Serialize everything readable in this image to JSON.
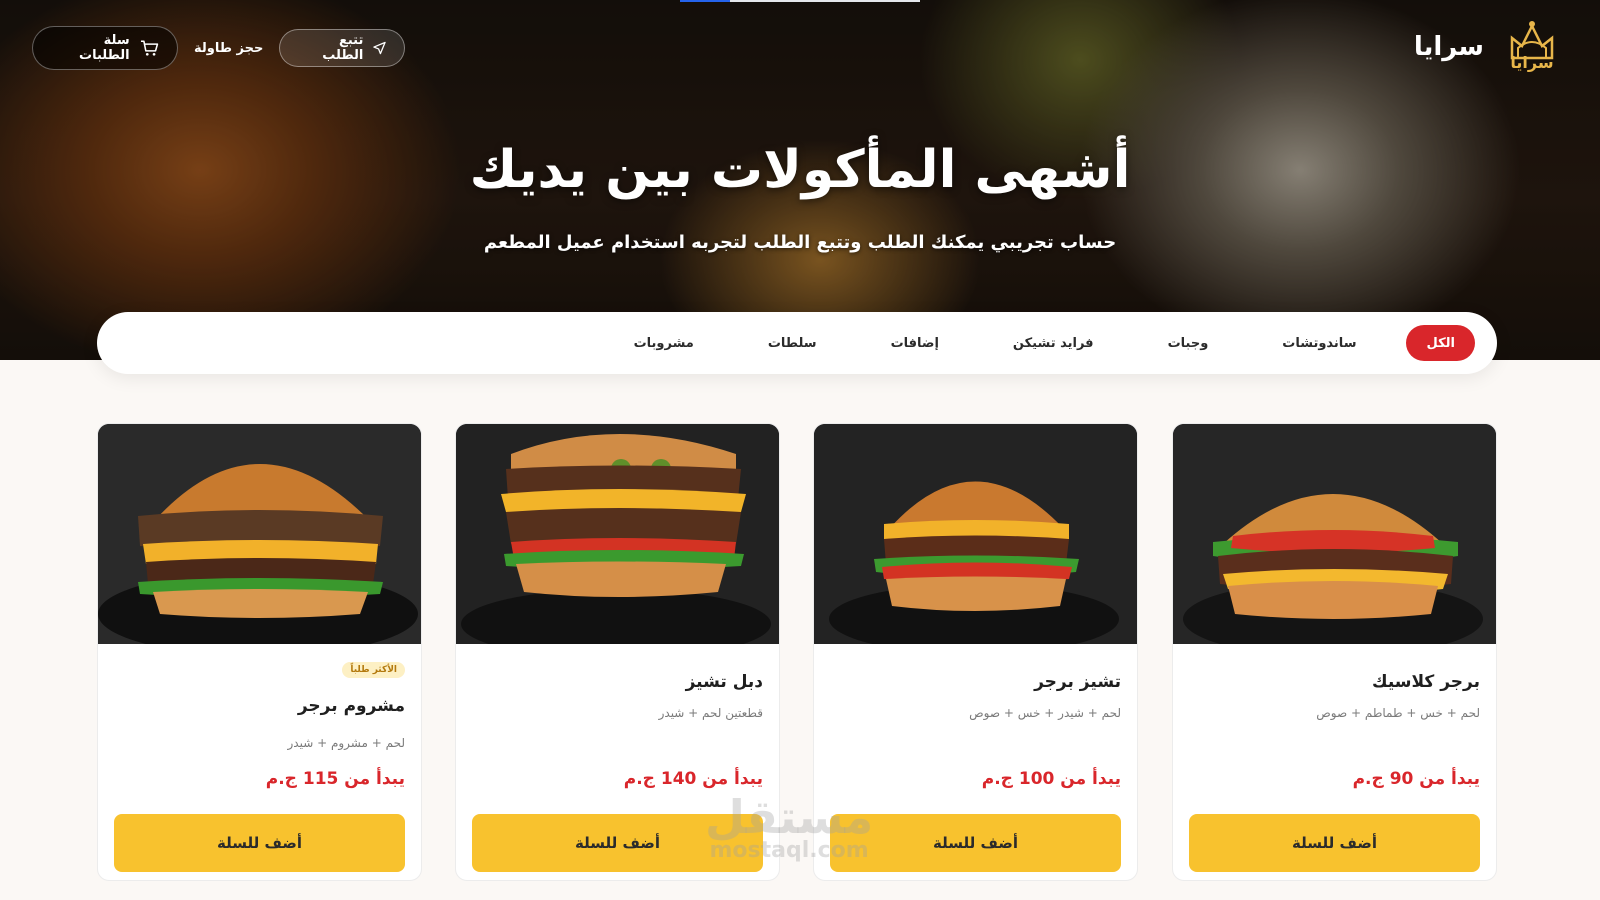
{
  "brand": {
    "name": "سرايا",
    "logo_text": "سرايا"
  },
  "nav": {
    "cart_label": "سلة الطلبات",
    "reserve_label": "حجز طاولة",
    "track_label": "تتبع الطلب"
  },
  "hero": {
    "title": "أشهى المأكولات بين يديك",
    "subtitle": "حساب تجريبي يمكنك الطلب وتتبع الطلب لتجربه استخدام عميل المطعم"
  },
  "categories": [
    "الكل",
    "ساندوتشات",
    "وجبات",
    "فرايد تشيكن",
    "إضافات",
    "سلطات",
    "مشروبات"
  ],
  "products": [
    {
      "name": "برجر كلاسيك",
      "desc": "لحم + خس + طماطم + صوص",
      "price": "يبدأ من 90 ج.م",
      "button": "أضف للسلة",
      "badge": ""
    },
    {
      "name": "تشيز برجر",
      "desc": "لحم + شيدر + خس + صوص",
      "price": "يبدأ من 100 ج.م",
      "button": "أضف للسلة",
      "badge": ""
    },
    {
      "name": "دبل تشيز",
      "desc": "قطعتين لحم + شيدر",
      "price": "يبدأ من 140 ج.م",
      "button": "أضف للسلة",
      "badge": ""
    },
    {
      "name": "مشروم برجر",
      "desc": "لحم + مشروم + شيدر",
      "price": "يبدأ من 115 ج.م",
      "button": "أضف للسلة",
      "badge": "الأكثر طلباً"
    }
  ],
  "watermark": {
    "ar": "مستقل",
    "en": "mostaql.com"
  },
  "colors": {
    "accent": "#d9262b",
    "button": "#f8c22e",
    "price": "#d9262b"
  }
}
